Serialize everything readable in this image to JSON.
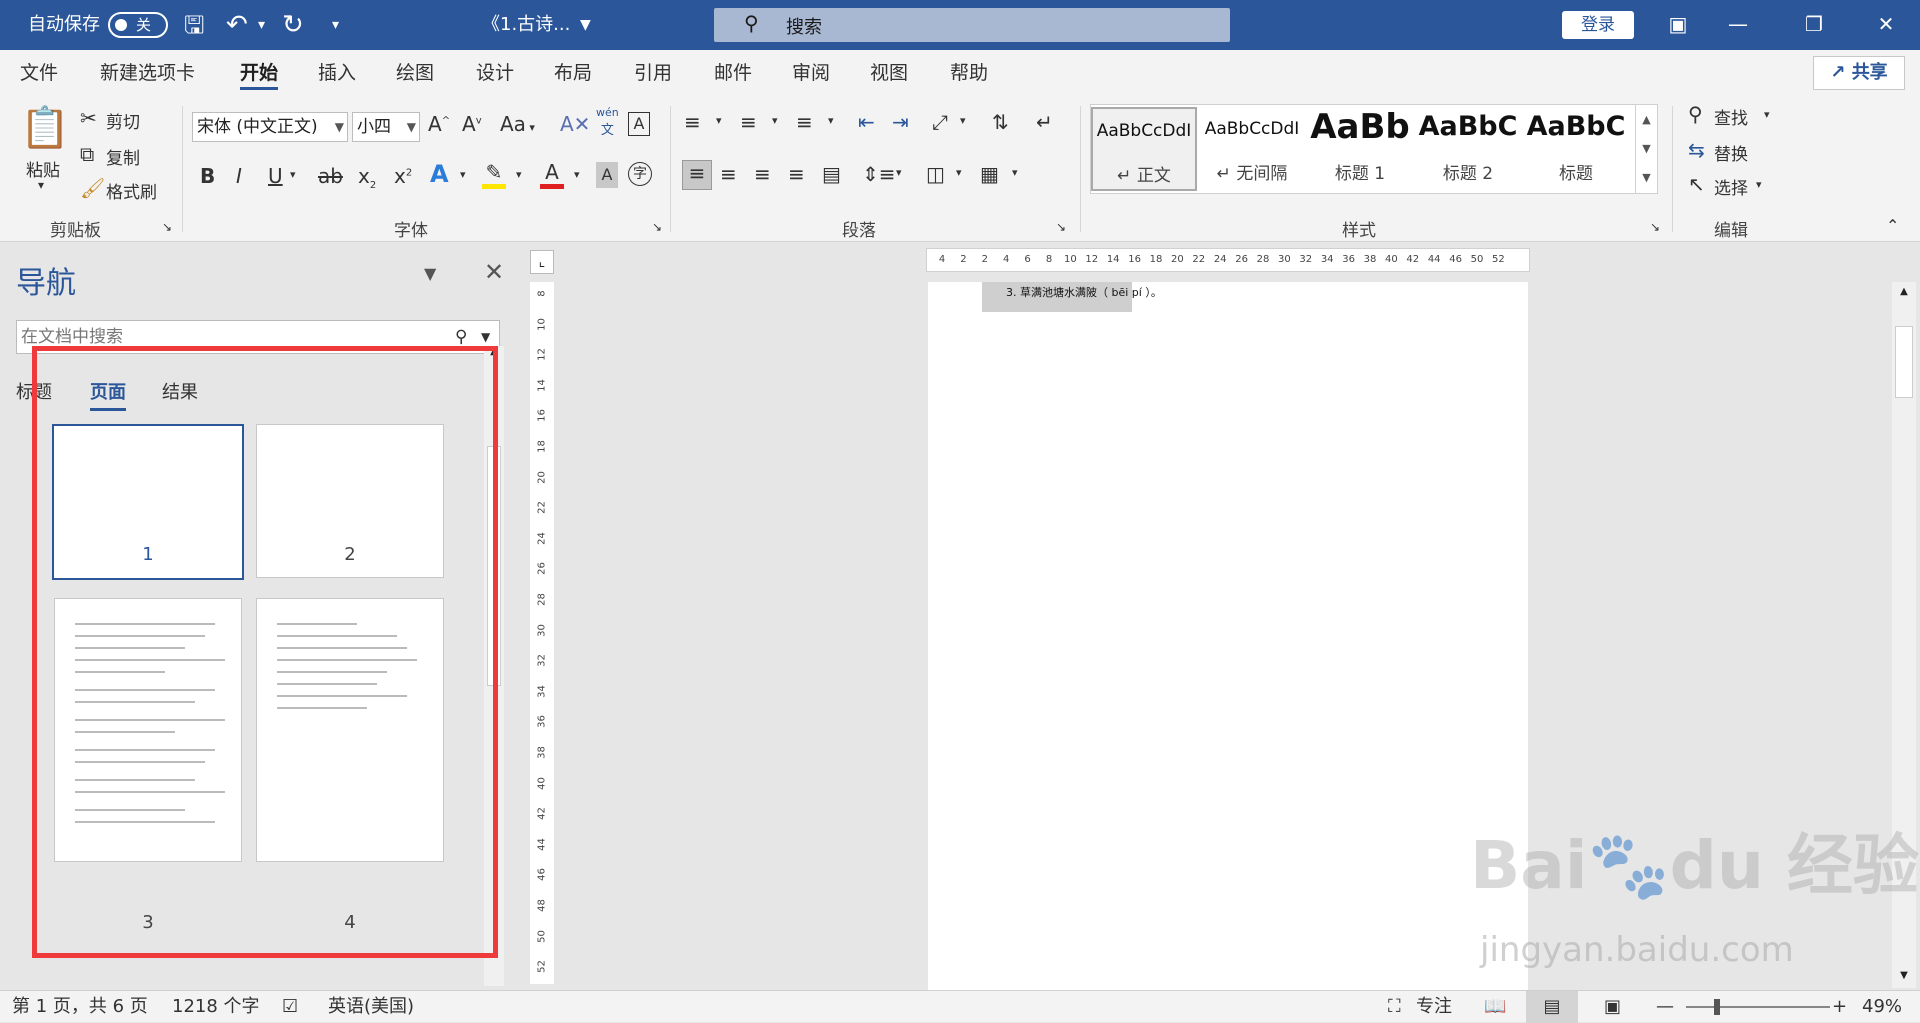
{
  "titlebar": {
    "autosave_label": "自动保存",
    "autosave_state": "关",
    "doc_title": "《1.古诗...",
    "search_placeholder": "搜索",
    "signin_label": "登录",
    "bg_color": "#2b579a"
  },
  "tabs": [
    {
      "label": "文件"
    },
    {
      "label": "新建选项卡"
    },
    {
      "label": "开始",
      "active": true
    },
    {
      "label": "插入"
    },
    {
      "label": "绘图"
    },
    {
      "label": "设计"
    },
    {
      "label": "布局"
    },
    {
      "label": "引用"
    },
    {
      "label": "邮件"
    },
    {
      "label": "审阅"
    },
    {
      "label": "视图"
    },
    {
      "label": "帮助"
    }
  ],
  "share_label": "共享",
  "ribbon": {
    "clipboard": {
      "group_label": "剪贴板",
      "paste": "粘贴",
      "cut": "剪切",
      "copy": "复制",
      "format_painter": "格式刷"
    },
    "font": {
      "group_label": "字体",
      "font_name": "宋体 (中文正文)",
      "font_size": "小四",
      "change_case": "Aa",
      "phonetic": "wén"
    },
    "paragraph": {
      "group_label": "段落"
    },
    "styles": {
      "group_label": "样式",
      "items": [
        {
          "preview": "AaBbCcDdI",
          "name": "正文"
        },
        {
          "preview": "AaBbCcDdI",
          "name": "无间隔"
        },
        {
          "preview": "AaBb",
          "name": "标题 1"
        },
        {
          "preview": "AaBbC",
          "name": "标题 2"
        },
        {
          "preview": "AaBbC",
          "name": "标题"
        }
      ]
    },
    "editing": {
      "group_label": "编辑",
      "find": "查找",
      "replace": "替换",
      "select": "选择"
    }
  },
  "nav": {
    "title": "导航",
    "search_placeholder": "在文档中搜索",
    "tabs": [
      {
        "label": "标题"
      },
      {
        "label": "页面",
        "active": true
      },
      {
        "label": "结果"
      }
    ],
    "pages": [
      "1",
      "2",
      "3",
      "4"
    ],
    "selected_page": "1"
  },
  "document": {
    "line_text": "3. 草满池塘水满陂（ bēi  pí ）。"
  },
  "hruler_ticks": [
    "4",
    "2",
    "2",
    "4",
    "6",
    "8",
    "10",
    "12",
    "14",
    "16",
    "18",
    "20",
    "22",
    "24",
    "26",
    "28",
    "30",
    "32",
    "34",
    "36",
    "38",
    "40",
    "42",
    "44",
    "46",
    "50",
    "52"
  ],
  "vruler_ticks": [
    "8",
    "10",
    "12",
    "14",
    "16",
    "18",
    "20",
    "22",
    "24",
    "26",
    "28",
    "30",
    "32",
    "34",
    "36",
    "38",
    "40",
    "42",
    "44",
    "46",
    "48",
    "50",
    "52"
  ],
  "status": {
    "page_info": "第 1 页，共 6 页",
    "word_count": "1218 个字",
    "language": "英语(美国)",
    "focus": "专注",
    "zoom": "49%",
    "zoom_fraction": 0.49
  },
  "watermark": "jingyan.baidu.com"
}
